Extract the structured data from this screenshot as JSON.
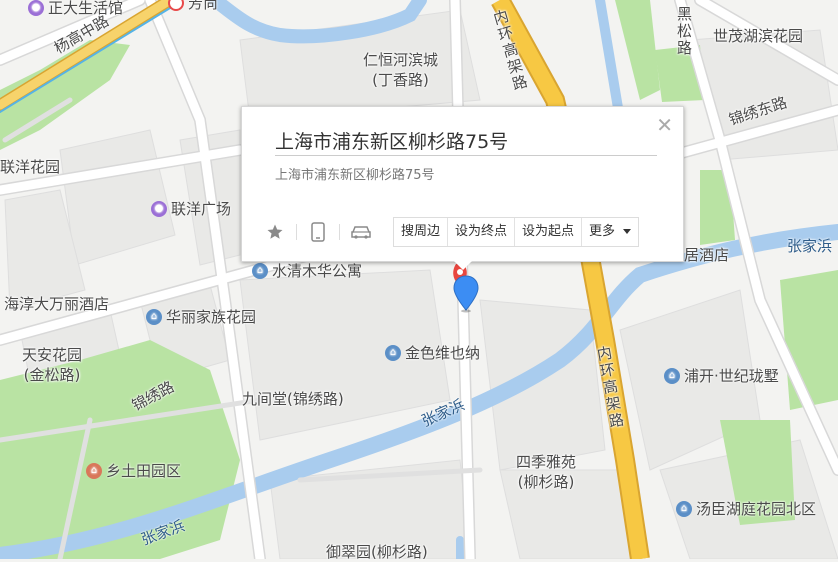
{
  "popup": {
    "title": "上海市浦东新区柳杉路75号",
    "address": "上海市浦东新区柳杉路75号",
    "actions": [
      "搜周边",
      "设为终点",
      "设为起点",
      "更多"
    ]
  },
  "roads": {
    "yanggao_middle": "杨高中路",
    "inner_ring_top": "内环高架路",
    "inner_ring_bottom": "内环高架路",
    "heisong": "黑松路",
    "jinxiu_east": "锦绣东路",
    "jinxiu": "锦绣路"
  },
  "water": {
    "zhangjiabang_1": "张家浜",
    "zhangjiabang_2": "张家浜",
    "zhangjiabang_3": "张家浜"
  },
  "places": {
    "zhengda": "正大生活馆",
    "fangshang": "芳尚",
    "renheng": [
      "仁恒河滨城",
      "(丁香路)"
    ],
    "shimao": "世茂湖滨花园",
    "lianyang_garden": "联洋花园",
    "lianyang_plaza": "联洋广场",
    "shuiqing": "水清木华公寓",
    "hotel_left": "海淳大万丽酒店",
    "hotel_right": "居酒店",
    "huali": "华丽家族花园",
    "jinse": "金色维也纳",
    "tianan": [
      "天安花园",
      "(金松路)"
    ],
    "jiujiantang": "九间堂(锦绣路)",
    "sijiyayuan": [
      "四季雅苑",
      "(柳杉路)"
    ],
    "pukai": "浦开·世纪珑墅",
    "tangchen": "汤臣湖庭花园北区",
    "xiangtutian": "乡土田园区",
    "yucuiyuan": "御翠园(柳杉路)"
  },
  "colors": {
    "land": "#f3f3f1",
    "block": "#e8e8e6",
    "road": "#ffffff",
    "highway": "#f7c843",
    "highway_edge": "#d9a531",
    "green": "#b7e4a1",
    "water": "#a9ccee",
    "marker_blue": "#3c8df3",
    "marker_red": "#e8463f"
  },
  "icons": [
    "star-icon",
    "phone-icon",
    "car-icon",
    "close-icon",
    "dropdown-caret-icon",
    "location-marker-icon"
  ]
}
